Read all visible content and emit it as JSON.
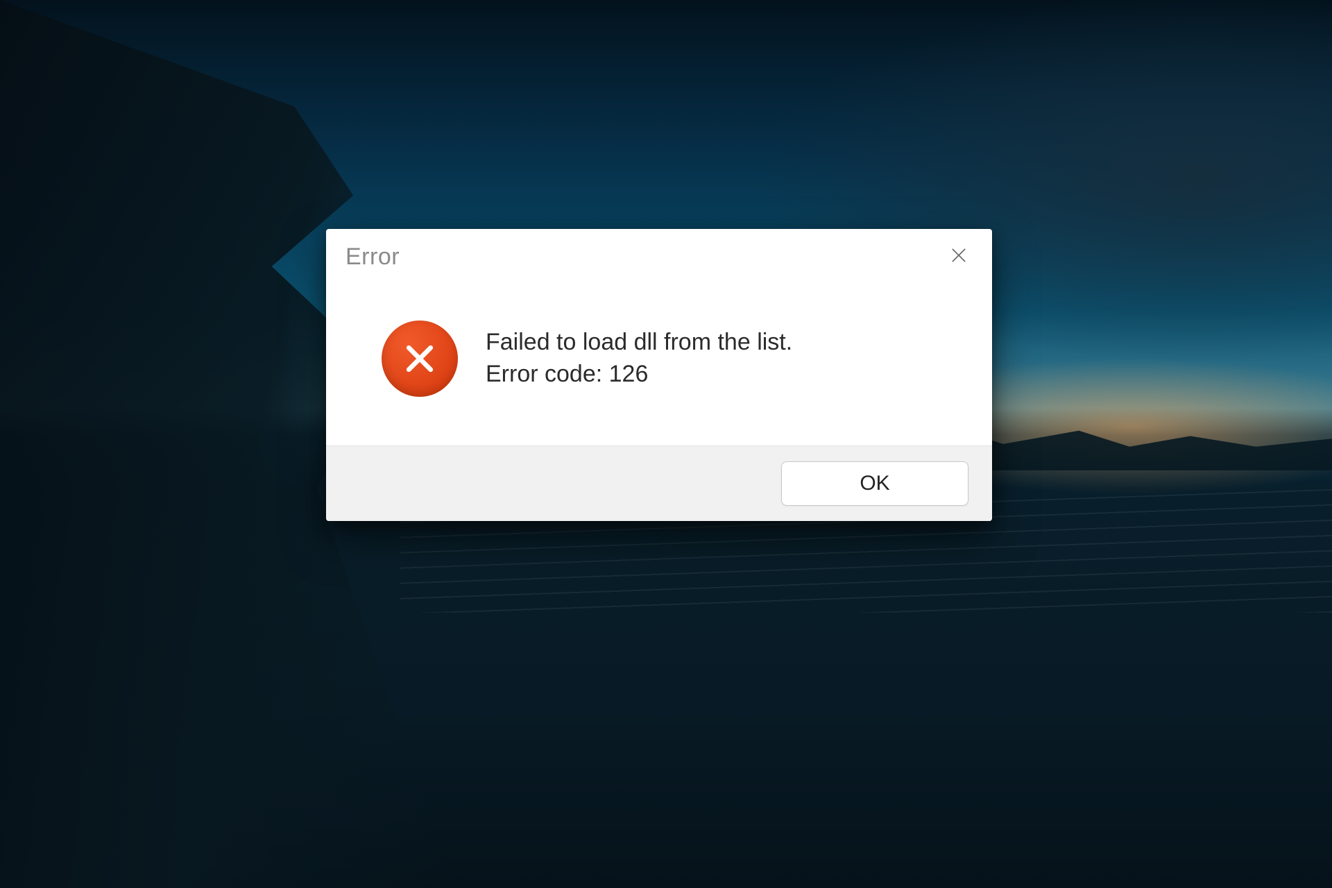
{
  "dialog": {
    "title": "Error",
    "message_line1": "Failed to load dll from the list.",
    "message_line2": "Error code: 126",
    "ok_label": "OK",
    "icon_name": "error-x-icon",
    "icon_color": "#e04a1a"
  }
}
